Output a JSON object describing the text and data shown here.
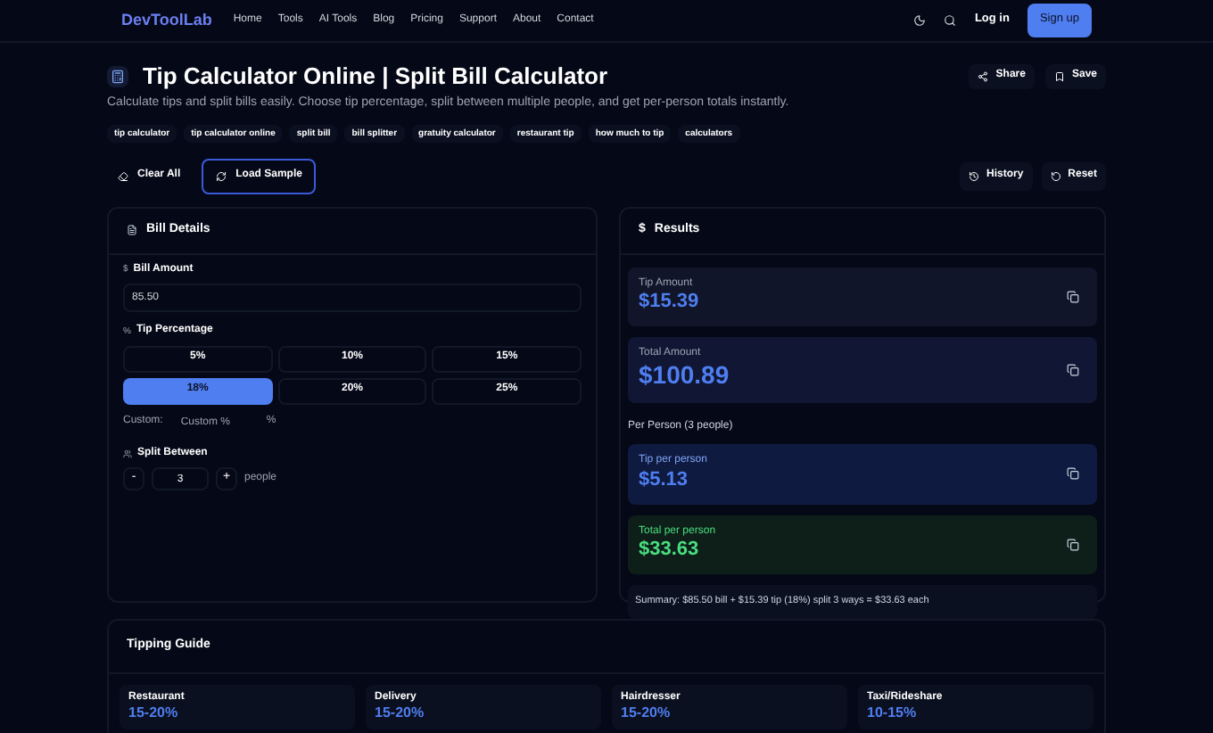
{
  "nav": {
    "logo": "DevToolLab",
    "links": [
      "Home",
      "Tools",
      "AI Tools",
      "Blog",
      "Pricing",
      "Support",
      "About",
      "Contact"
    ],
    "login": "Log in",
    "signup": "Sign up"
  },
  "header": {
    "title": "Tip Calculator Online | Split Bill Calculator",
    "subtitle": "Calculate tips and split bills easily. Choose tip percentage, split between multiple people, and get per-person totals instantly.",
    "share": "Share",
    "save": "Save"
  },
  "tags": [
    "tip calculator",
    "tip calculator online",
    "split bill",
    "bill splitter",
    "gratuity calculator",
    "restaurant tip",
    "how much to tip",
    "calculators"
  ],
  "actions": {
    "clear": "Clear All",
    "sample": "Load Sample",
    "history": "History",
    "reset": "Reset"
  },
  "bill": {
    "title": "Bill Details",
    "amount_label": "Bill Amount",
    "amount_icon": "$",
    "amount": "85.50",
    "tip_label": "Tip Percentage",
    "tip_icon": "%",
    "tips": [
      {
        "label": "5%",
        "selected": false
      },
      {
        "label": "10%",
        "selected": false
      },
      {
        "label": "15%",
        "selected": false
      },
      {
        "label": "18%",
        "selected": true
      },
      {
        "label": "20%",
        "selected": false
      },
      {
        "label": "25%",
        "selected": false
      }
    ],
    "custom_label": "Custom:",
    "custom_placeholder": "Custom %",
    "custom_unit": "%",
    "split_label": "Split Between",
    "minus": "-",
    "people": "3",
    "plus": "+",
    "people_unit": "people"
  },
  "results": {
    "icon": "$",
    "title": "Results",
    "totals": [
      {
        "label": "Tip Amount",
        "value": "$15.39",
        "kind": "plain"
      },
      {
        "label": "Total Amount",
        "value": "$100.89",
        "kind": "large"
      }
    ],
    "per_person_title": "Per Person (3 people)",
    "per_person": [
      {
        "label": "Tip per person",
        "value": "$5.13",
        "kind": "blue"
      },
      {
        "label": "Total per person",
        "value": "$33.63",
        "kind": "green"
      }
    ],
    "summary": "Summary: $85.50 bill + $15.39 tip (18%) split 3 ways = $33.63 each"
  },
  "guide": {
    "title": "Tipping Guide",
    "items": [
      {
        "name": "Restaurant",
        "range": "15-20%"
      },
      {
        "name": "Delivery",
        "range": "15-20%"
      },
      {
        "name": "Hairdresser",
        "range": "15-20%"
      },
      {
        "name": "Taxi/Rideshare",
        "range": "10-15%"
      }
    ]
  }
}
